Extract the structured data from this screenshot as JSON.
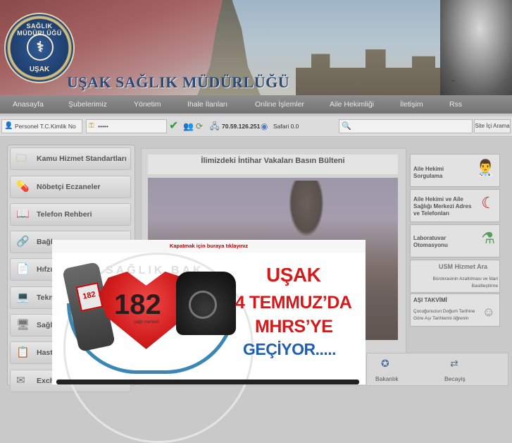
{
  "header": {
    "logo": {
      "top_text": "SAĞLIK MÜDÜRLÜĞÜ",
      "bottom_text": "UŞAK"
    },
    "title": "UŞAK SAĞLIK MÜDÜRLÜĞÜ"
  },
  "topnav": {
    "items": [
      {
        "label": "Anasayfa"
      },
      {
        "label": "Şubelerimiz"
      },
      {
        "label": "Yönetim"
      },
      {
        "label": "Ihale İlanları"
      },
      {
        "label": "Online İşlemler"
      },
      {
        "label": "Aile Hekimliği"
      },
      {
        "label": "İletişim"
      },
      {
        "label": "Rss"
      }
    ]
  },
  "loginbar": {
    "tc_placeholder": "Personel T.C.Kimlik No",
    "password_mask": "•••••",
    "ip_address": "70.59.126.251",
    "browser": "Safari 0.0",
    "search_button": "Site İçi Arama"
  },
  "sidebar": {
    "items": [
      {
        "label": "Kamu Hizmet Standartları",
        "icon": "folder-icon"
      },
      {
        "label": "Nöbetçi Eczaneler",
        "icon": "pill-icon"
      },
      {
        "label": "Telefon Rehberi",
        "icon": "book-icon"
      },
      {
        "label": "Bağla",
        "icon": "link-icon"
      },
      {
        "label": "Hıfzıs",
        "icon": "document-icon"
      },
      {
        "label": "Tekno",
        "icon": "computer-icon"
      },
      {
        "label": "Sağlı",
        "icon": "monitor-icon"
      },
      {
        "label": "Hasta",
        "icon": "clipboard-icon"
      },
      {
        "label": "Exche",
        "icon": "mail-icon"
      }
    ]
  },
  "news": {
    "title": "İlimizdeki İntihar Vakaları Basın Bülteni"
  },
  "right_panel": {
    "boxes": [
      {
        "label": "Aile Hekimi Sorgulama"
      },
      {
        "label": "Aile Hekimi ve Aile Sağlığı Merkezi Adres ve Telefonları"
      },
      {
        "label": "Laboratuvar Otomasyonu"
      },
      {
        "label": "USM Hizmet Ara",
        "sub": "Bürokrasinin Azaltılması ve İdari Basitleştirme"
      },
      {
        "label": "AŞI TAKVİMİ",
        "sub": "Çocuğunuzun Doğum Tarihine Göre Aşı Tarihlerini öğrenin"
      }
    ]
  },
  "bottom_links": [
    {
      "label": "Bakanlık"
    },
    {
      "label": "Becayiş"
    }
  ],
  "popup": {
    "close_text": "Kapatmak için buraya tıklayınız",
    "cell_number": "182",
    "heart_number": "182",
    "heart_sub": "çağrı merkezi",
    "lines": [
      "UŞAK",
      "4 TEMMUZ’DA",
      "MHRS’YE",
      "GEÇİYOR....."
    ],
    "watermark": "SAĞLIK BAK"
  }
}
